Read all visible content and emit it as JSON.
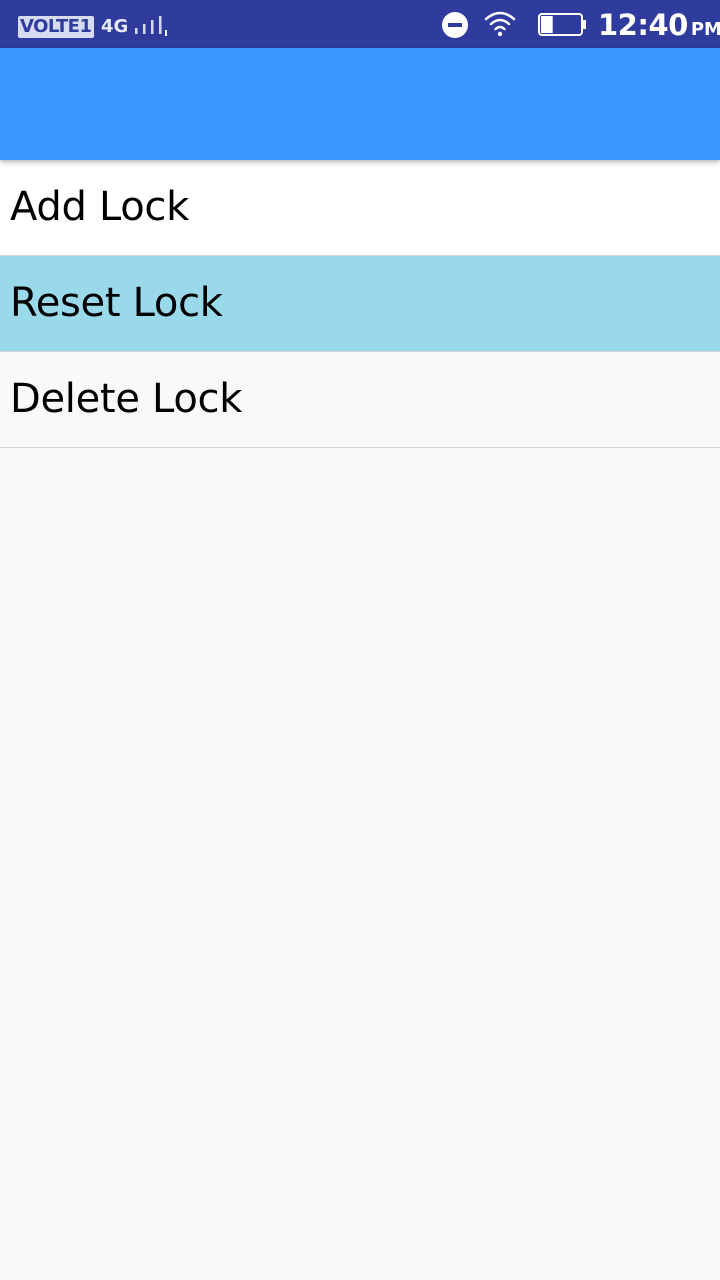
{
  "status_bar": {
    "volte_label": "VOLTE1",
    "network_type": "4G",
    "time": "12:40",
    "ampm": "PM",
    "icons": [
      "signal-icon",
      "dnd-icon",
      "wifi-icon",
      "battery-icon"
    ],
    "battery_level": 0.3
  },
  "app_bar": {
    "title": "",
    "color": "#3797ff"
  },
  "menu": {
    "items": [
      {
        "label": "Add Lock",
        "background": "#ffffff",
        "selected": false
      },
      {
        "label": "Reset Lock",
        "background": "#99d9ea",
        "selected": true
      },
      {
        "label": "Delete Lock",
        "background": "#f9f9f9",
        "selected": false
      }
    ]
  },
  "colors": {
    "status_bar": "#2f3c9e",
    "app_bar": "#3797ff",
    "highlight": "#99d9ea",
    "page_background": "#f9f9f9"
  }
}
